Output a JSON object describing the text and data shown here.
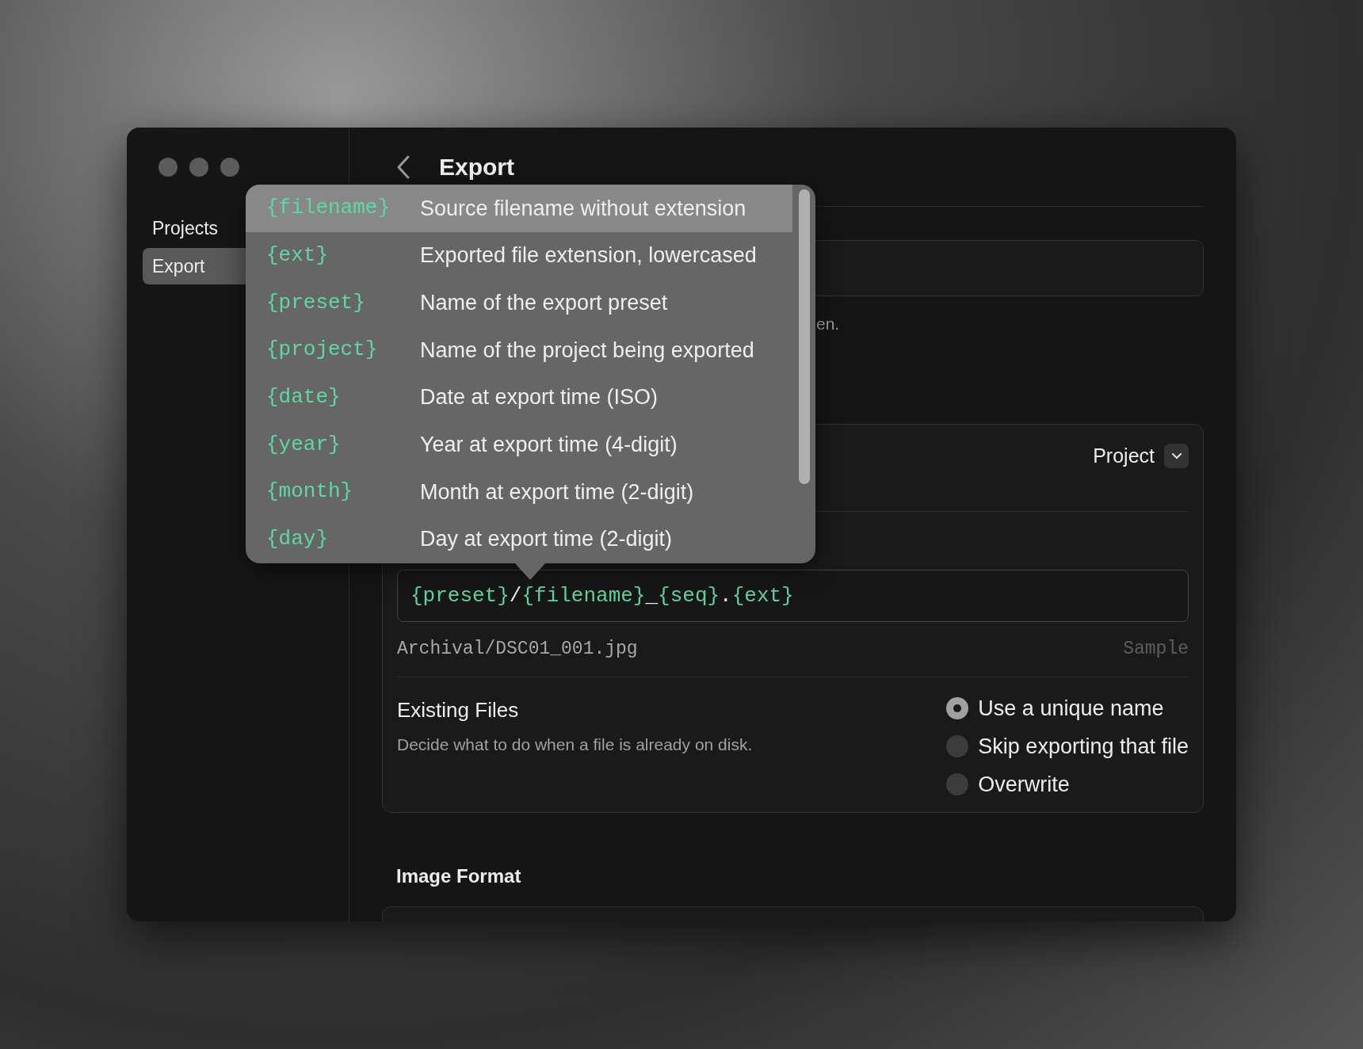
{
  "sidebar": {
    "items": [
      {
        "label": "Projects",
        "selected": false
      },
      {
        "label": "Export",
        "selected": true
      }
    ]
  },
  "header": {
    "title": "Export"
  },
  "hint_fragment": "en.",
  "naming_card": {
    "scope_dropdown": {
      "value": "Project"
    },
    "template_field": {
      "segments": [
        {
          "text": "{preset}",
          "kind": "token"
        },
        {
          "text": "/",
          "kind": "literal"
        },
        {
          "text": "{filename}",
          "kind": "token"
        },
        {
          "text": "_",
          "kind": "literal"
        },
        {
          "text": "{seq}",
          "kind": "token"
        },
        {
          "text": ".",
          "kind": "literal"
        },
        {
          "text": "{ext}",
          "kind": "token"
        }
      ]
    },
    "sample": {
      "value": "Archival/DSC01_001.jpg",
      "label": "Sample"
    },
    "existing_files": {
      "title": "Existing Files",
      "description": "Decide what to do when a file is already on disk.",
      "options": [
        {
          "label": "Use a unique name",
          "selected": true
        },
        {
          "label": "Skip exporting that file",
          "selected": false
        },
        {
          "label": "Overwrite",
          "selected": false
        }
      ]
    }
  },
  "image_format": {
    "title": "Image Format"
  },
  "token_menu": {
    "items": [
      {
        "token": "{filename}",
        "description": "Source filename without extension",
        "selected": true
      },
      {
        "token": "{ext}",
        "description": "Exported file extension, lowercased",
        "selected": false
      },
      {
        "token": "{preset}",
        "description": "Name of the export preset",
        "selected": false
      },
      {
        "token": "{project}",
        "description": "Name of the project being exported",
        "selected": false
      },
      {
        "token": "{date}",
        "description": "Date at export time (ISO)",
        "selected": false
      },
      {
        "token": "{year}",
        "description": "Year at export time (4-digit)",
        "selected": false
      },
      {
        "token": "{month}",
        "description": "Month at export time (2-digit)",
        "selected": false
      },
      {
        "token": "{day}",
        "description": "Day at export time (2-digit)",
        "selected": false
      }
    ]
  }
}
